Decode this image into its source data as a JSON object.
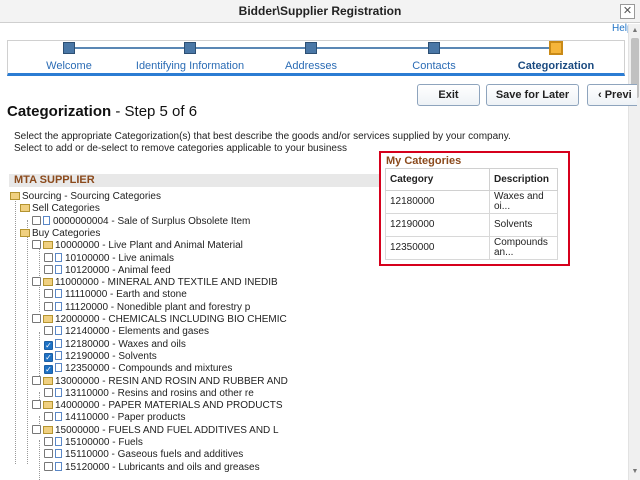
{
  "window": {
    "title": "Bidder\\Supplier Registration",
    "close_glyph": "✕",
    "help": "Help"
  },
  "train": {
    "steps": [
      {
        "label": "Welcome"
      },
      {
        "label": "Identifying Information"
      },
      {
        "label": "Addresses"
      },
      {
        "label": "Contacts"
      },
      {
        "label": "Categorization"
      }
    ],
    "current_index": 4
  },
  "buttons": {
    "exit": "Exit",
    "save_for_later": "Save for Later",
    "previous": "‹ Previ"
  },
  "page": {
    "title": "Categorization",
    "subtitle": " - Step 5 of 6",
    "instruction_1": "Select the appropriate Categorization(s) that best describe the goods and/or services supplied by your company.",
    "instruction_2": "Select to add or de-select to remove categories applicable to your business"
  },
  "supplier_header": "MTA SUPPLIER",
  "tree": [
    {
      "label": "Sourcing - Sourcing Categories",
      "type": "folder",
      "checkbox": false
    },
    {
      "label": "Sell Categories",
      "type": "folder",
      "checkbox": false
    },
    {
      "label": "0000000004 - Sale of Surplus Obsolete Item",
      "type": "doc",
      "checkbox": true,
      "checked": false
    },
    {
      "label": "Buy Categories",
      "type": "folder",
      "checkbox": false
    },
    {
      "label": "10000000 - Live Plant and Animal Material",
      "type": "folder",
      "checkbox": true,
      "checked": false
    },
    {
      "label": "10100000 - Live animals",
      "type": "doc",
      "checkbox": true,
      "checked": false
    },
    {
      "label": "10120000 - Animal feed",
      "type": "doc",
      "checkbox": true,
      "checked": false
    },
    {
      "label": "11000000 - MINERAL AND TEXTILE AND INEDIB",
      "type": "folder",
      "checkbox": true,
      "checked": false
    },
    {
      "label": "11110000 - Earth and stone",
      "type": "doc",
      "checkbox": true,
      "checked": false
    },
    {
      "label": "11120000 - Nonedible plant and forestry p",
      "type": "doc",
      "checkbox": true,
      "checked": false
    },
    {
      "label": "12000000 - CHEMICALS INCLUDING BIO CHEMIC",
      "type": "folder",
      "checkbox": true,
      "checked": false
    },
    {
      "label": "12140000 - Elements and gases",
      "type": "doc",
      "checkbox": true,
      "checked": false
    },
    {
      "label": "12180000 - Waxes and oils",
      "type": "doc",
      "checkbox": true,
      "checked": true
    },
    {
      "label": "12190000 - Solvents",
      "type": "doc",
      "checkbox": true,
      "checked": true
    },
    {
      "label": "12350000 - Compounds and mixtures",
      "type": "doc",
      "checkbox": true,
      "checked": true
    },
    {
      "label": "13000000 - RESIN AND ROSIN AND RUBBER AND",
      "type": "folder",
      "checkbox": true,
      "checked": false
    },
    {
      "label": "13110000 - Resins and rosins and other re",
      "type": "doc",
      "checkbox": true,
      "checked": false
    },
    {
      "label": "14000000 - PAPER MATERIALS AND PRODUCTS",
      "type": "folder",
      "checkbox": true,
      "checked": false
    },
    {
      "label": "14110000 - Paper products",
      "type": "doc",
      "checkbox": true,
      "checked": false
    },
    {
      "label": "15000000 - FUELS AND FUEL ADDITIVES AND L",
      "type": "folder",
      "checkbox": true,
      "checked": false
    },
    {
      "label": "15100000 - Fuels",
      "type": "doc",
      "checkbox": true,
      "checked": false
    },
    {
      "label": "15110000 - Gaseous fuels and additives",
      "type": "doc",
      "checkbox": true,
      "checked": false
    },
    {
      "label": "15120000 - Lubricants and oils and greases",
      "type": "doc",
      "checkbox": true,
      "checked": false
    }
  ],
  "my_categories": {
    "title": "My Categories",
    "headers": [
      "Category",
      "Description"
    ],
    "rows": [
      [
        "12180000",
        "Waxes and oi..."
      ],
      [
        "12190000",
        "Solvents"
      ],
      [
        "12350000",
        "Compounds an..."
      ]
    ]
  },
  "colors": {
    "accent": "#2b7cd3",
    "highlight_border": "#d6001c",
    "section_title": "#8b4a1c"
  }
}
